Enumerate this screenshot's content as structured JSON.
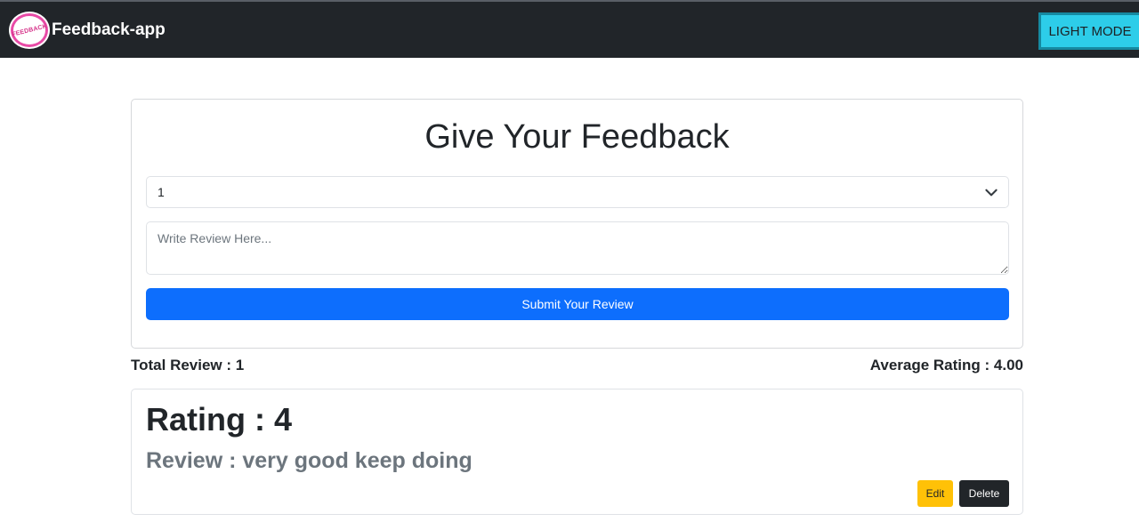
{
  "navbar": {
    "brand": "Feedback-app",
    "logo_text": "FEEDBACK",
    "mode_button": "LIGHT MODE",
    "background": "#212529"
  },
  "form": {
    "title": "Give Your Feedback",
    "rating_select": {
      "value": "1",
      "icon": "chevron-down-icon"
    },
    "review_placeholder": "Write Review Here...",
    "submit_label": "Submit Your Review",
    "submit_color": "#0d6efd"
  },
  "stats": {
    "total_review": "Total Review : 1",
    "average_rating": "Average Rating : 4.00"
  },
  "reviews": [
    {
      "rating": "Rating : 4",
      "review": "Review : very good keep doing",
      "edit_label": "Edit",
      "delete_label": "Delete",
      "edit_color": "#ffc107",
      "delete_color": "#212529"
    }
  ]
}
